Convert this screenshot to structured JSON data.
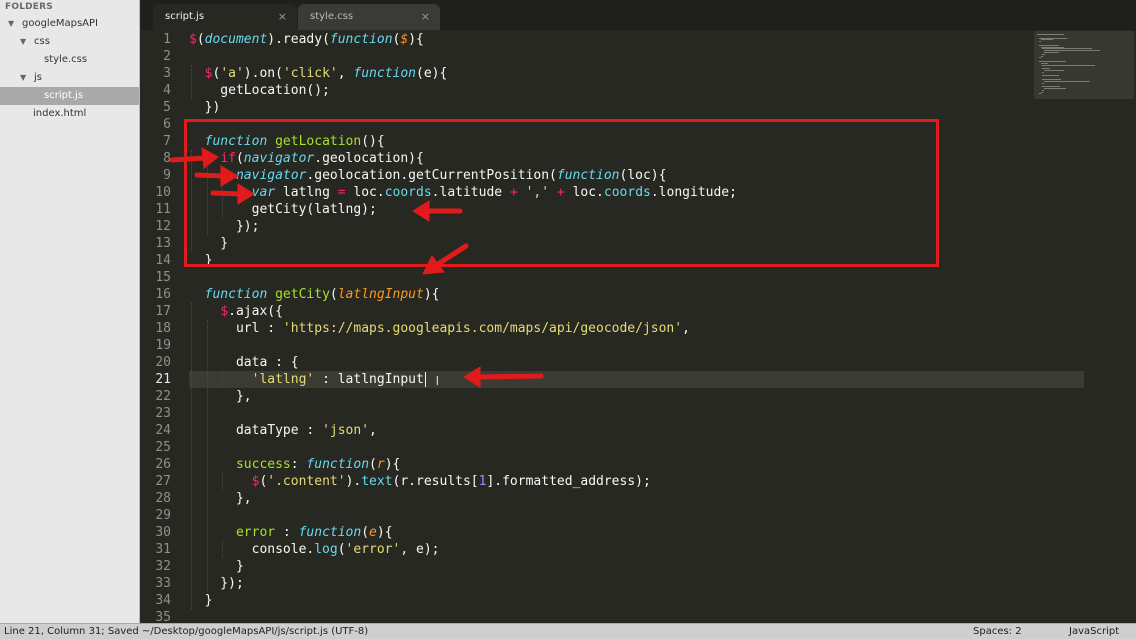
{
  "sidebar": {
    "header": "FOLDERS",
    "root": "googleMapsAPI",
    "css_folder": "css",
    "css_file": "style.css",
    "js_folder": "js",
    "js_file": "script.js",
    "html_file": "index.html"
  },
  "tabs": [
    {
      "label": "script.js",
      "active": true
    },
    {
      "label": "style.css",
      "active": false
    }
  ],
  "tab_close": "×",
  "editor": {
    "current_line": 21,
    "lines": [
      [
        [
          "$",
          "kw"
        ],
        [
          "(",
          "plain"
        ],
        [
          "document",
          "fn"
        ],
        [
          ").ready(",
          "plain"
        ],
        [
          "function",
          "fn"
        ],
        [
          "(",
          "plain"
        ],
        [
          "$",
          "arg"
        ],
        [
          "){",
          "plain"
        ]
      ],
      [],
      [
        [
          "  ",
          "plain"
        ],
        [
          "$",
          "kw"
        ],
        [
          "(",
          "plain"
        ],
        [
          "'a'",
          "str"
        ],
        [
          ").on(",
          "plain"
        ],
        [
          "'click'",
          "str"
        ],
        [
          ", ",
          "plain"
        ],
        [
          "function",
          "fn"
        ],
        [
          "(e){",
          "plain"
        ]
      ],
      [
        [
          "    getLocation();",
          "plain"
        ]
      ],
      [
        [
          "  })",
          "plain"
        ]
      ],
      [],
      [
        [
          "  ",
          "plain"
        ],
        [
          "function",
          "fn"
        ],
        [
          " ",
          "plain"
        ],
        [
          "getLocation",
          "name"
        ],
        [
          "(){",
          "plain"
        ]
      ],
      [
        [
          "    ",
          "plain"
        ],
        [
          "if",
          "kw"
        ],
        [
          "(",
          "plain"
        ],
        [
          "navigator",
          "fn"
        ],
        [
          ".geolocation){",
          "plain"
        ]
      ],
      [
        [
          "      ",
          "plain"
        ],
        [
          "navigator",
          "fn"
        ],
        [
          ".geolocation.getCurrentPosition(",
          "plain"
        ],
        [
          "function",
          "fn"
        ],
        [
          "(loc){",
          "plain"
        ]
      ],
      [
        [
          "        ",
          "plain"
        ],
        [
          "var",
          "fn"
        ],
        [
          " latlng ",
          "plain"
        ],
        [
          "=",
          "kw"
        ],
        [
          " loc.",
          "plain"
        ],
        [
          "coords",
          "prop"
        ],
        [
          ".latitude ",
          "plain"
        ],
        [
          "+",
          "kw"
        ],
        [
          " ",
          "plain"
        ],
        [
          "','",
          "str"
        ],
        [
          " ",
          "plain"
        ],
        [
          "+",
          "kw"
        ],
        [
          " loc.",
          "plain"
        ],
        [
          "coords",
          "prop"
        ],
        [
          ".longitude;",
          "plain"
        ]
      ],
      [
        [
          "        getCity(latlng);",
          "plain"
        ]
      ],
      [
        [
          "      });",
          "plain"
        ]
      ],
      [
        [
          "    }",
          "plain"
        ]
      ],
      [
        [
          "  }",
          "plain"
        ]
      ],
      [],
      [
        [
          "  ",
          "plain"
        ],
        [
          "function",
          "fn"
        ],
        [
          " ",
          "plain"
        ],
        [
          "getCity",
          "name"
        ],
        [
          "(",
          "plain"
        ],
        [
          "latlngInput",
          "arg"
        ],
        [
          "){",
          "plain"
        ]
      ],
      [
        [
          "    ",
          "plain"
        ],
        [
          "$",
          "kw"
        ],
        [
          ".ajax({",
          "plain"
        ]
      ],
      [
        [
          "      url : ",
          "plain"
        ],
        [
          "'https://maps.googleapis.com/maps/api/geocode/json'",
          "str"
        ],
        [
          ",",
          "plain"
        ]
      ],
      [],
      [
        [
          "      data : {",
          "plain"
        ]
      ],
      [
        [
          "        ",
          "plain"
        ],
        [
          "'latlng'",
          "str"
        ],
        [
          " : latlngInput",
          "plain"
        ]
      ],
      [
        [
          "      },",
          "plain"
        ]
      ],
      [],
      [
        [
          "      dataType : ",
          "plain"
        ],
        [
          "'json'",
          "str"
        ],
        [
          ",",
          "plain"
        ]
      ],
      [],
      [
        [
          "      ",
          "plain"
        ],
        [
          "success",
          "name"
        ],
        [
          ": ",
          "plain"
        ],
        [
          "function",
          "fn"
        ],
        [
          "(",
          "plain"
        ],
        [
          "r",
          "arg"
        ],
        [
          "){",
          "plain"
        ]
      ],
      [
        [
          "        ",
          "plain"
        ],
        [
          "$",
          "kw"
        ],
        [
          "(",
          "plain"
        ],
        [
          "'.content'",
          "str"
        ],
        [
          ").",
          "plain"
        ],
        [
          "text",
          "sup"
        ],
        [
          "(r.results[",
          "plain"
        ],
        [
          "1",
          "num"
        ],
        [
          "].formatted_address);",
          "plain"
        ]
      ],
      [
        [
          "      },",
          "plain"
        ]
      ],
      [],
      [
        [
          "      ",
          "plain"
        ],
        [
          "error",
          "name"
        ],
        [
          " : ",
          "plain"
        ],
        [
          "function",
          "fn"
        ],
        [
          "(",
          "plain"
        ],
        [
          "e",
          "arg"
        ],
        [
          "){",
          "plain"
        ]
      ],
      [
        [
          "        console.",
          "plain"
        ],
        [
          "log",
          "sup"
        ],
        [
          "(",
          "plain"
        ],
        [
          "'error'",
          "str"
        ],
        [
          ", e);",
          "plain"
        ]
      ],
      [
        [
          "      }",
          "plain"
        ]
      ],
      [
        [
          "    });",
          "plain"
        ]
      ],
      [
        [
          "  }",
          "plain"
        ]
      ],
      []
    ]
  },
  "colors": {
    "background": "#272822",
    "annotation_red": "#e11b1b",
    "keyword": "#f92672",
    "string": "#e6db74",
    "function_name": "#a6e22e",
    "storage": "#66d9ef",
    "argument": "#fd971f",
    "number": "#ae81ff"
  },
  "status": {
    "left": "Line 21, Column 31; Saved ~/Desktop/googleMapsAPI/js/script.js (UTF-8)",
    "spaces": "Spaces: 2",
    "syntax": "JavaScript"
  },
  "icons": {
    "folder_open": "triangle-down",
    "tab_close": "close-x",
    "text_cursor": "i-beam",
    "annotation_arrow": "red-arrow"
  }
}
